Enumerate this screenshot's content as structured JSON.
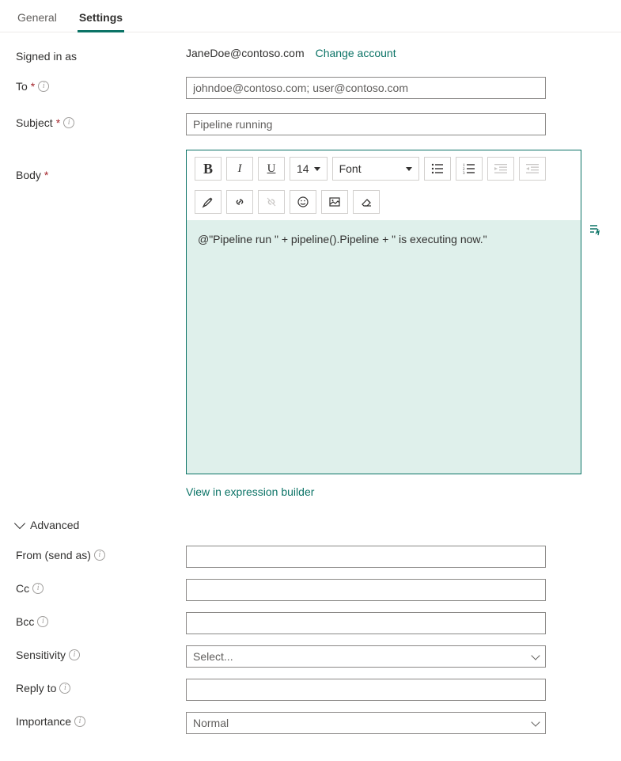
{
  "tabs": {
    "general": "General",
    "settings": "Settings"
  },
  "signed_in": {
    "label": "Signed in as",
    "email": "JaneDoe@contoso.com",
    "change_link": "Change account"
  },
  "to": {
    "label": "To",
    "value": "johndoe@contoso.com; user@contoso.com"
  },
  "subject": {
    "label": "Subject",
    "value": "Pipeline running"
  },
  "body": {
    "label": "Body",
    "content": "@\"Pipeline run \" + pipeline().Pipeline + \" is executing now.\"",
    "view_link": "View in expression builder",
    "toolbar": {
      "bold": "B",
      "italic": "I",
      "underline": "U",
      "fontsize": "14",
      "font_label": "Font"
    }
  },
  "advanced": {
    "header": "Advanced",
    "from": {
      "label": "From (send as)",
      "value": ""
    },
    "cc": {
      "label": "Cc",
      "value": ""
    },
    "bcc": {
      "label": "Bcc",
      "value": ""
    },
    "sensitivity": {
      "label": "Sensitivity",
      "value": "Select..."
    },
    "reply_to": {
      "label": "Reply to",
      "value": ""
    },
    "importance": {
      "label": "Importance",
      "value": "Normal"
    }
  }
}
